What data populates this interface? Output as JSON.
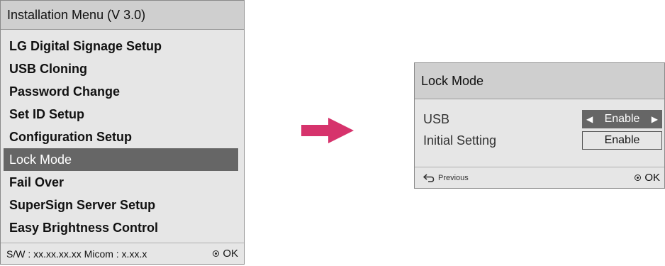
{
  "installation_menu": {
    "title": "Installation Menu (V 3.0)",
    "items": [
      {
        "label": "LG Digital Signage Setup",
        "selected": false
      },
      {
        "label": "USB Cloning",
        "selected": false
      },
      {
        "label": "Password Change",
        "selected": false
      },
      {
        "label": "Set ID Setup",
        "selected": false
      },
      {
        "label": "Configuration Setup",
        "selected": false
      },
      {
        "label": "Lock Mode",
        "selected": true
      },
      {
        "label": "Fail Over",
        "selected": false
      },
      {
        "label": "SuperSign Server Setup",
        "selected": false
      },
      {
        "label": "Easy Brightness Control",
        "selected": false
      }
    ],
    "footer_info": "S/W : xx.xx.xx.xx Micom : x.xx.x",
    "ok_label": "OK"
  },
  "arrow_color": "#d6336c",
  "lock_mode": {
    "title": "Lock Mode",
    "usb_label": "USB",
    "usb_value": "Enable",
    "initial_setting_label": "Initial Setting",
    "initial_setting_value": "Enable",
    "previous_label": "Previous",
    "ok_label": "OK"
  },
  "colors": {
    "panel_bg": "#e6e6e6",
    "header_bg": "#cfcfcf",
    "selected_bg": "#666666"
  }
}
